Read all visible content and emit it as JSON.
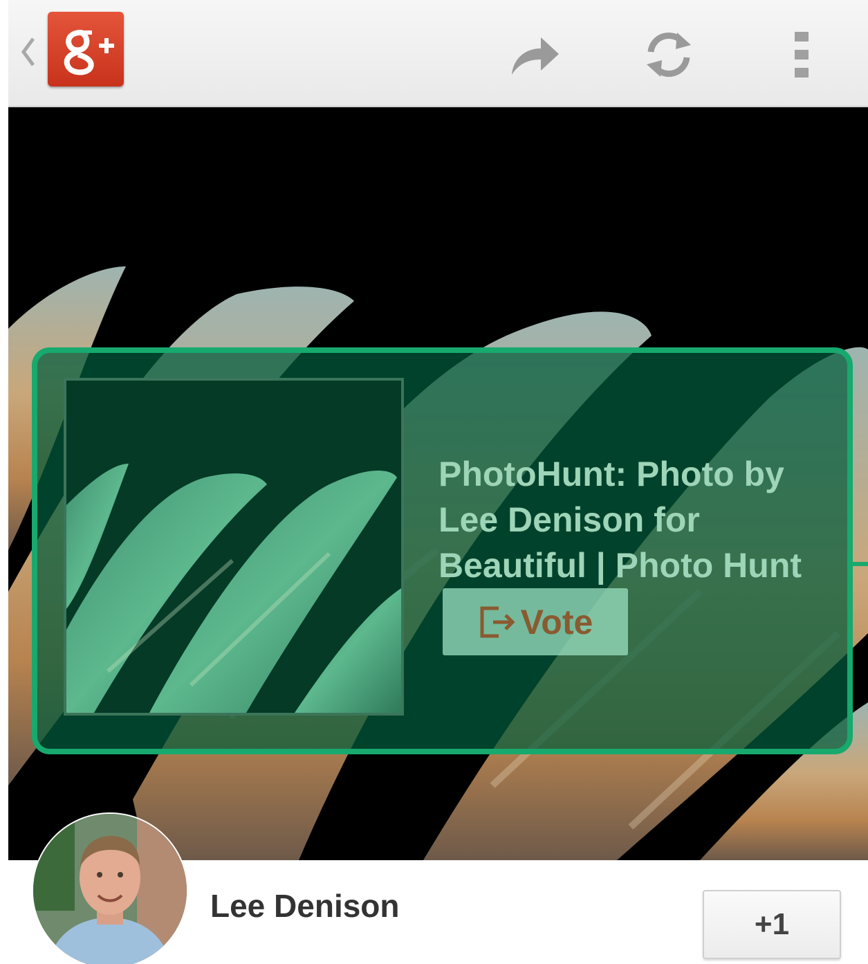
{
  "action_bar": {
    "app_logo_text": "g+",
    "icons": [
      "back-chevron-icon",
      "share-icon",
      "refresh-icon",
      "overflow-menu-icon"
    ]
  },
  "card": {
    "title": "PhotoHunt: Photo by Lee Denison for Beautiful | Photo Hunt",
    "action_label": "Vote",
    "action_icon": "open-external-icon"
  },
  "author": {
    "name": "Lee Denison"
  },
  "plus_one": {
    "label": "+1"
  },
  "colors": {
    "card_border": "#17a96e",
    "card_tint": "#005c3c",
    "title_text": "#9ed4b8",
    "vote_text": "#8a5a30",
    "gplus_red": "#d8442a"
  }
}
